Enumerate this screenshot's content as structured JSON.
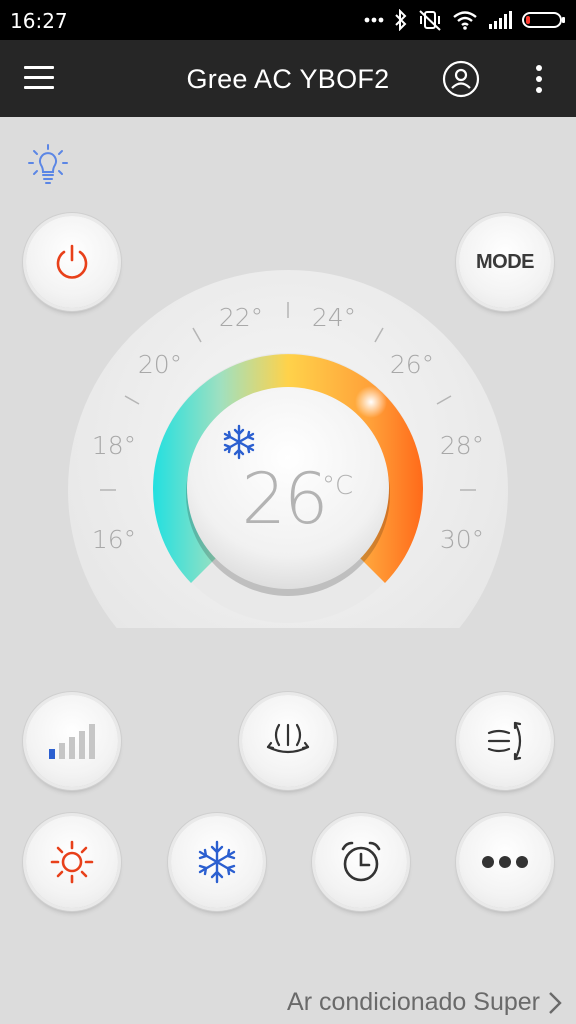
{
  "status_bar": {
    "time": "16:27",
    "icons": [
      "more-dots-icon",
      "bluetooth-icon",
      "vibrate-off-icon",
      "wifi-icon",
      "signal-icon",
      "battery-icon"
    ]
  },
  "app_bar": {
    "title": "Gree AC YBOF2",
    "menu_icon": "menu-icon",
    "account_icon": "account-icon",
    "overflow_icon": "overflow-menu-icon"
  },
  "controls": {
    "light_icon": "lightbulb-icon",
    "power_icon": "power-icon",
    "mode_label": "MODE"
  },
  "thermostat": {
    "temperature": "26",
    "unit": "°C",
    "mode_icon": "snowflake-icon",
    "scale_labels": [
      "16°",
      "18°",
      "20°",
      "22°",
      "24°",
      "26°",
      "28°",
      "30°"
    ],
    "min": 16,
    "max": 30,
    "colors": {
      "cool": "#22e0e0",
      "warm_mid": "#ffd24a",
      "hot": "#ff6a1a"
    }
  },
  "function_buttons": {
    "row1": [
      "fan-speed-icon",
      "vertical-swing-icon",
      "horizontal-swing-icon"
    ],
    "row2": [
      "sun-heat-icon",
      "snowflake-cool-icon",
      "alarm-clock-icon",
      "more-icon"
    ],
    "accent_heat": "#e8401a",
    "accent_cool": "#2b5fd0"
  },
  "footer": {
    "link_text": "Ar condicionado Super"
  }
}
